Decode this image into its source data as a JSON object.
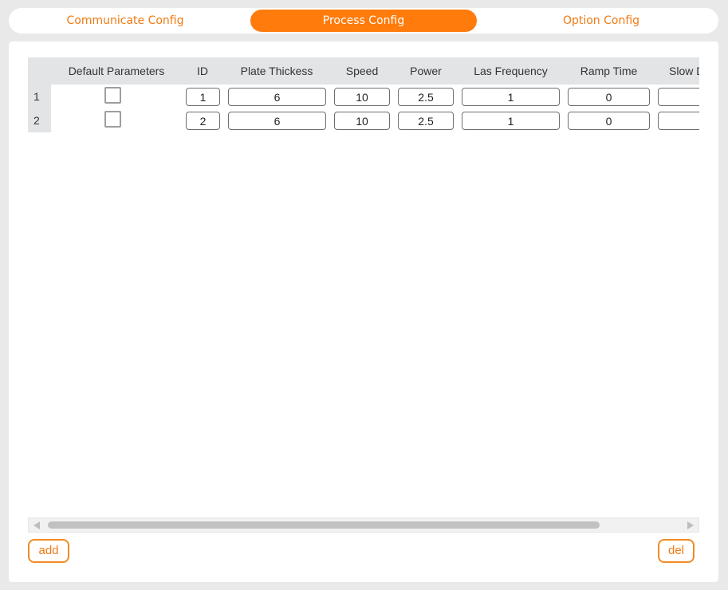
{
  "tabs": [
    {
      "label": "Communicate Config",
      "active": false
    },
    {
      "label": "Process Config",
      "active": true
    },
    {
      "label": "Option Config",
      "active": false
    }
  ],
  "table": {
    "columns": [
      "Default Parameters",
      "ID",
      "Plate Thickess",
      "Speed",
      "Power",
      "Las Frequency",
      "Ramp Time",
      "Slow D"
    ],
    "rows": [
      {
        "index": "1",
        "default": false,
        "id": "1",
        "plate_thickness": "6",
        "speed": "10",
        "power": "2.5",
        "las_frequency": "1",
        "ramp_time": "0",
        "slow": ""
      },
      {
        "index": "2",
        "default": false,
        "id": "2",
        "plate_thickness": "6",
        "speed": "10",
        "power": "2.5",
        "las_frequency": "1",
        "ramp_time": "0",
        "slow": ""
      }
    ]
  },
  "buttons": {
    "add": "add",
    "del": "del"
  },
  "colors": {
    "accent": "#ff7b0b",
    "background": "#e9e9ea",
    "header_bg": "#e2e4e6"
  }
}
